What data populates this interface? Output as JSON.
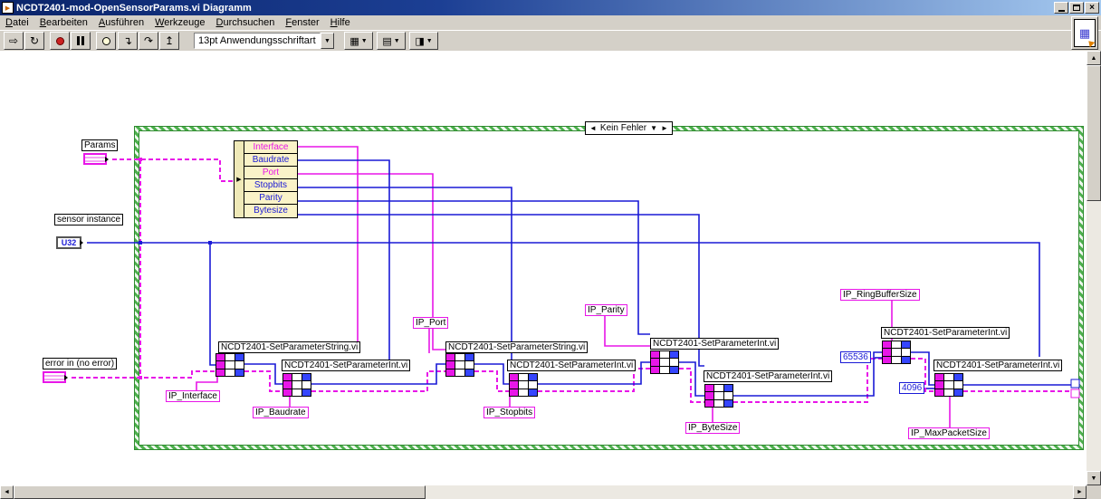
{
  "window": {
    "title": "NCDT2401-mod-OpenSensorParams.vi Diagramm"
  },
  "menu": {
    "items": [
      "Datei",
      "Bearbeiten",
      "Ausführen",
      "Werkzeuge",
      "Durchsuchen",
      "Fenster",
      "Hilfe"
    ]
  },
  "toolbar": {
    "font_selector": "13pt Anwendungsschriftart"
  },
  "diagram": {
    "case_selector": "Kein Fehler",
    "terminals": {
      "params_label": "Params",
      "sensor_label": "sensor instance",
      "sensor_type": "U32",
      "error_label": "error in (no error)"
    },
    "unbundle": [
      {
        "name": "Interface",
        "type": "string"
      },
      {
        "name": "Baudrate",
        "type": "int"
      },
      {
        "name": "Port",
        "type": "string"
      },
      {
        "name": "Stopbits",
        "type": "int"
      },
      {
        "name": "Parity",
        "type": "int"
      },
      {
        "name": "Bytesize",
        "type": "int"
      }
    ],
    "vi_nodes": [
      {
        "label": "NCDT2401-SetParameterString.vi"
      },
      {
        "label": "NCDT2401-SetParameterInt.vi"
      },
      {
        "label": "NCDT2401-SetParameterString.vi"
      },
      {
        "label": "NCDT2401-SetParameterInt.vi"
      },
      {
        "label": "NCDT2401-SetParameterInt.vi"
      },
      {
        "label": "NCDT2401-SetParameterInt.vi"
      },
      {
        "label": "NCDT2401-SetParameterInt.vi"
      },
      {
        "label": "NCDT2401-SetParameterInt.vi"
      }
    ],
    "string_constants": [
      "IP_Interface",
      "IP_Baudrate",
      "IP_Port",
      "IP_Stopbits",
      "IP_Parity",
      "IP_ByteSize",
      "IP_RingBufferSize",
      "IP_MaxPacketSize"
    ],
    "numeric_constants": [
      "65536",
      "4096"
    ],
    "colors": {
      "wire_int": "#1a1ad6",
      "wire_string": "#e816e8",
      "case_border": "#2e8b2e"
    }
  }
}
